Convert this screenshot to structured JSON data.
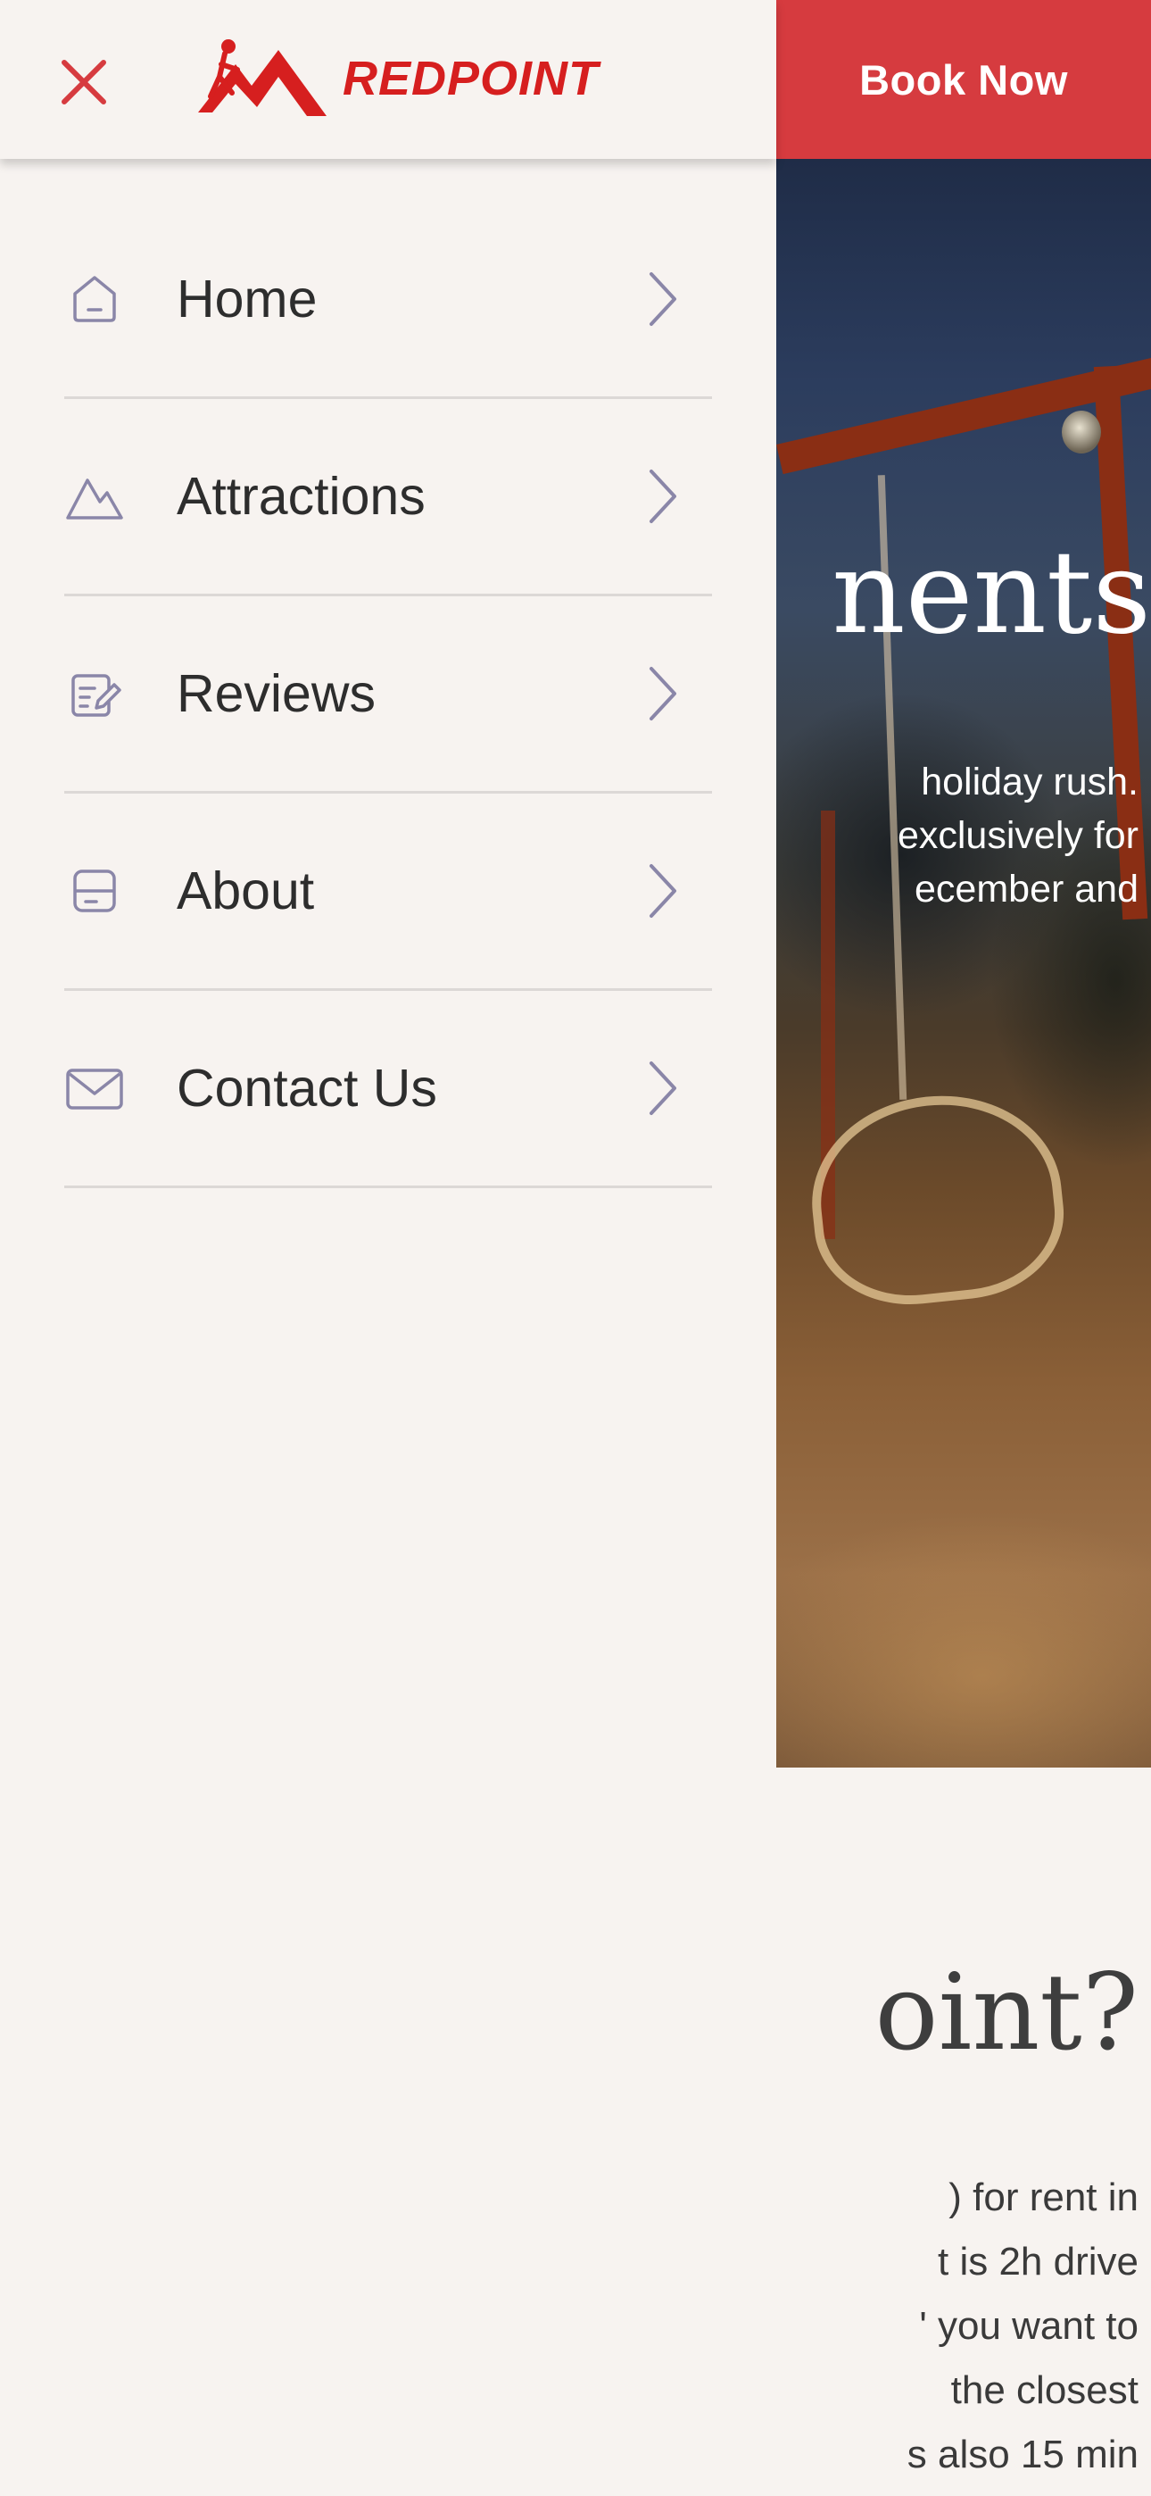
{
  "brand": {
    "name": "REDPOINT",
    "logo_icon": "climber-mountain-logo",
    "accent_color": "#d63b3f"
  },
  "header": {
    "close_icon": "close-icon",
    "book_now_label": "Book Now"
  },
  "menu": {
    "items": [
      {
        "label": "Home",
        "icon": "home-icon"
      },
      {
        "label": "Attractions",
        "icon": "mountain-icon"
      },
      {
        "label": "Reviews",
        "icon": "edit-note-icon"
      },
      {
        "label": "About",
        "icon": "panel-icon"
      },
      {
        "label": "Contact Us",
        "icon": "mail-icon"
      }
    ],
    "chevron_icon": "chevron-right-icon"
  },
  "background_page": {
    "hero_title_fragment": "nents",
    "hero_text_lines": [
      "holiday rush.",
      "exclusively for",
      "ecember and"
    ],
    "section_title_fragment": "oint?",
    "section_text_lines": [
      ") for rent in",
      "t is 2h drive",
      "' you want to",
      " the closest",
      "s also 15 min"
    ]
  }
}
